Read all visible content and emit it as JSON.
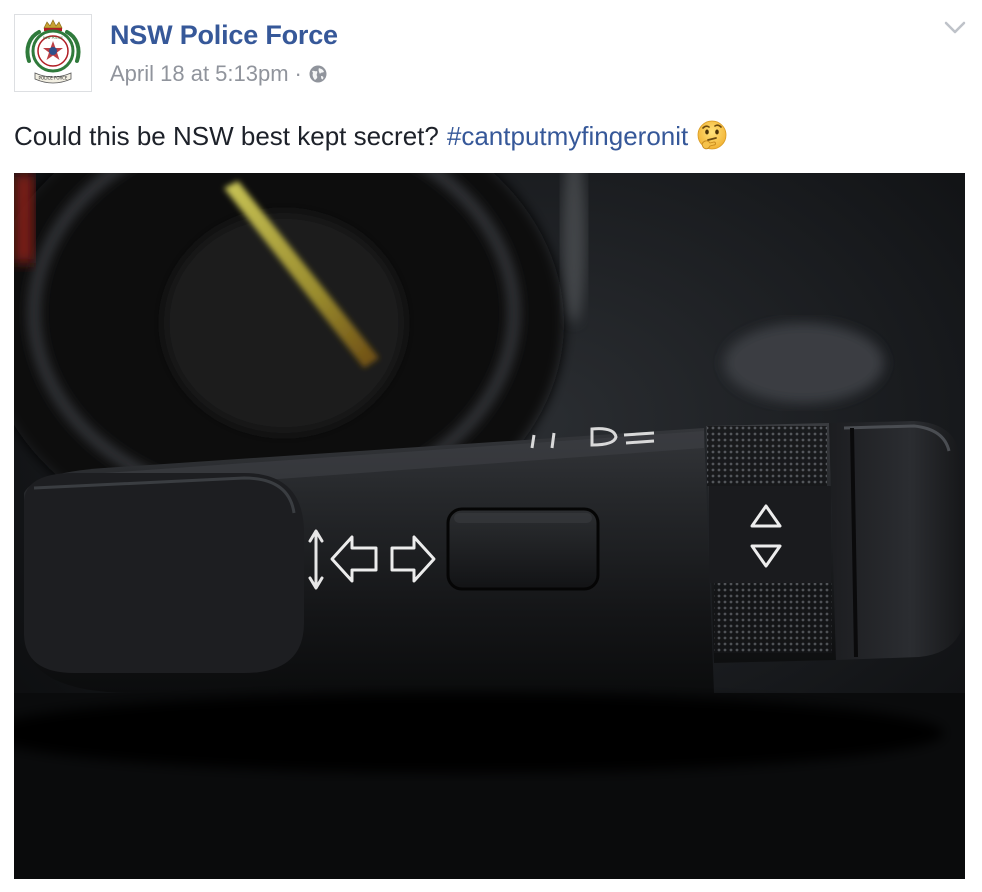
{
  "header": {
    "page_name": "NSW Police Force",
    "timestamp": "April 18 at 5:13pm",
    "separator": "·",
    "privacy_icon": "globe-icon",
    "options_icon": "chevron-down-icon",
    "avatar": {
      "banner_text": "NSW POLICE",
      "scroll_text": "POLICE FORCE"
    }
  },
  "post": {
    "text": "Could this be NSW best kept secret?",
    "hashtag": "#cantputmyfingeronit",
    "emoji": "thinking-face-emoji"
  },
  "photo": {
    "subject": "car-indicator-stalk",
    "symbols": [
      "up-down-arrow-icon",
      "left-arrow-icon",
      "right-arrow-icon",
      "triangle-up-icon",
      "triangle-down-icon",
      "headlight-icon"
    ]
  },
  "colors": {
    "link": "#365899",
    "text": "#1d2129",
    "meta": "#90949c",
    "border": "#dddfe2"
  }
}
